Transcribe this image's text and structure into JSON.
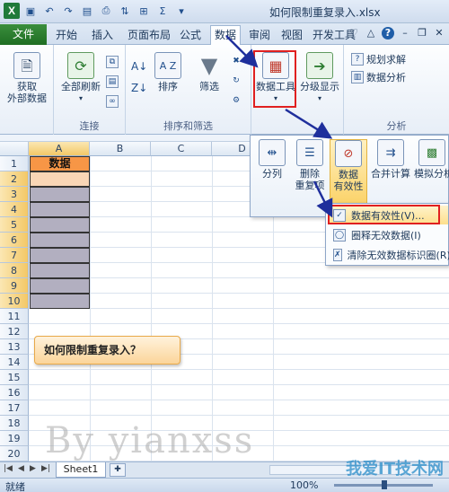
{
  "window": {
    "title": "如何限制重复录入.xlsx"
  },
  "qat": {
    "logo": "X"
  },
  "tabs": [
    {
      "label": "文件"
    },
    {
      "label": "开始"
    },
    {
      "label": "插入"
    },
    {
      "label": "页面布局"
    },
    {
      "label": "公式"
    },
    {
      "label": "数据"
    },
    {
      "label": "审阅"
    },
    {
      "label": "视图"
    },
    {
      "label": "开发工具"
    }
  ],
  "ribbon": {
    "get_external": "获取\n外部数据",
    "get_external_l1": "获取",
    "get_external_l2": "外部数据",
    "refresh_all": "全部刷新",
    "group_connect": "连接",
    "sort": "排序",
    "filter": "筛选",
    "group_sortfilter": "排序和筛选",
    "data_tools": "数据工具",
    "outline": "分级显示",
    "solver": "规划求解",
    "data_analysis": "数据分析",
    "group_analysis": "分析"
  },
  "grid": {
    "columns": [
      "A",
      "B",
      "C",
      "D"
    ],
    "rows": [
      "1",
      "2",
      "3",
      "4",
      "5",
      "6",
      "7",
      "8",
      "9",
      "10",
      "11",
      "12",
      "13",
      "14",
      "15",
      "16",
      "17",
      "18",
      "19",
      "20",
      "21"
    ],
    "a1": "数据",
    "callout": "如何限制重复录入？",
    "watermark": "By yianxss"
  },
  "data_tools_panel": {
    "text_to_columns": "分列",
    "remove_dup_l1": "删除",
    "remove_dup_l2": "重复项",
    "validation_l1": "数据",
    "validation_l2": "有效性",
    "consolidate": "合并计算",
    "what_if": "模拟分析"
  },
  "dropdown": {
    "items": [
      {
        "label": "数据有效性(V)..."
      },
      {
        "label": "圈释无效数据(I)"
      },
      {
        "label": "清除无效数据标识圈(R)"
      }
    ]
  },
  "sheets": {
    "tab": "Sheet1"
  },
  "status": {
    "ready": "就绪",
    "zoom": "100%"
  },
  "brand": "我爱IT技术网"
}
